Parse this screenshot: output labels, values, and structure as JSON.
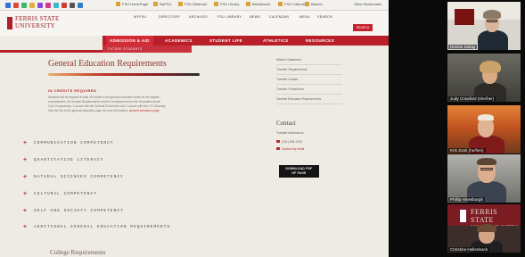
{
  "browser": {
    "bookmarks": [
      "FSU HomePage",
      "MyFSU",
      "FSU Webmail",
      "FSU Library",
      "Blackboard",
      "FSU Calendar",
      "Banner"
    ],
    "other_bookmarks": "Other Bookmarks"
  },
  "site": {
    "logo_line1": "FERRIS STATE",
    "logo_line2": "UNIVERSITY",
    "utility_nav": [
      "MYFSU",
      "DIRECTORY",
      "ARCHIVES",
      "FSU LIBRARY",
      "NEWS",
      "CALENDAR",
      "MENU",
      "SEARCH"
    ],
    "search_label": "SEARCH",
    "main_nav": [
      "ADMISSION & AID",
      "ACADEMICS",
      "STUDENT LIFE",
      "ATHLETICS",
      "RESOURCES"
    ],
    "subnav_label": "FUTURE STUDENTS"
  },
  "page": {
    "title": "General Education Requirements",
    "section_heading": "IN CREDITS REQUIRED",
    "intro_lines": [
      "Students will be required to take 39 credits in ten general education areas for the degree...",
      "competencies. All General Requirements must be completed before the Graduation Audit...",
      "Core Competency. 1 course with the Cultural Enrichment and 1 course with the U.S. Diversity",
      "Visit the link to the general education page for more information."
    ],
    "intro_link": "general education page",
    "competencies": [
      "COMMUNICATION COMPETENCY",
      "QUANTITATIVE LITERACY",
      "NATURAL SCIENCES COMPETENCY",
      "CULTURAL COMPETENCY",
      "SELF AND SOCIETY COMPETENCY",
      "ADDITIONAL GENERAL EDUCATION REQUIREMENTS"
    ],
    "footer_heading": "College Requirements"
  },
  "sidebar": {
    "links": [
      "Mission Statement",
      "Transfer Requirements",
      "Transfer Guides",
      "Transfer Procedures",
      "General Education Requirements"
    ],
    "contact_title": "Contact",
    "contact_name": "Transfer Admissions",
    "contact_phone": "(231) 591-2100",
    "contact_email": "Contact by email",
    "download_label_1": "DOWNLOAD PDF",
    "download_label_2": "OF PAGE"
  },
  "participants": [
    {
      "name": "Denise Sokay"
    },
    {
      "name": "Judy Crawford (she/her)"
    },
    {
      "name": "Kris Zook (he/him)"
    },
    {
      "name": "Phillip Hinesburgh"
    },
    {
      "name": "Christine Hallenback"
    }
  ],
  "colors": {
    "brand_red": "#b91f29",
    "page_bg": "#eeeae4",
    "title_color": "#8a3a2e"
  }
}
